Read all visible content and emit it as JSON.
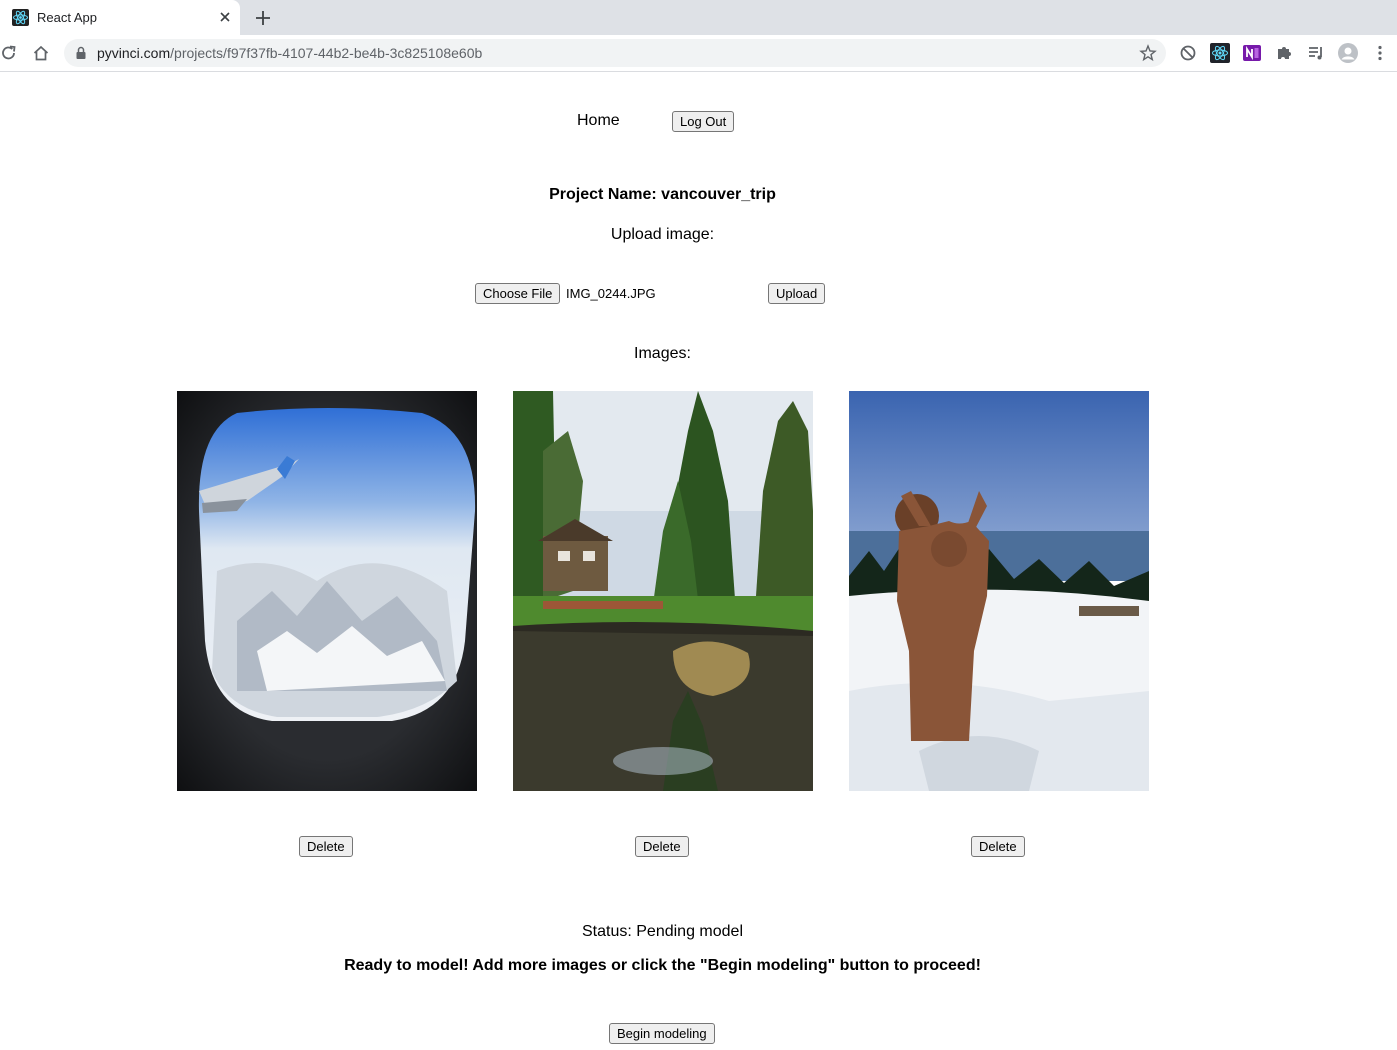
{
  "browser": {
    "tab_title": "React App",
    "url_host": "pyvinci.com",
    "url_path": "/projects/f97f37fb-4107-44b2-be4b-3c825108e60b"
  },
  "nav": {
    "home_label": "Home",
    "logout_label": "Log Out"
  },
  "project": {
    "title": "Project Name: vancouver_trip",
    "upload_label": "Upload image:",
    "choose_file_label": "Choose File",
    "selected_file": "IMG_0244.JPG",
    "upload_button": "Upload",
    "images_label": "Images:"
  },
  "images": [
    {
      "subject": "airplane-window-mountains",
      "delete_label": "Delete"
    },
    {
      "subject": "garden-pond-trees",
      "delete_label": "Delete"
    },
    {
      "subject": "statue-in-snow",
      "delete_label": "Delete"
    }
  ],
  "status": {
    "text": "Status: Pending model",
    "message": "Ready to model! Add more images or click the \"Begin modeling\" button to proceed!",
    "begin_button": "Begin modeling"
  }
}
